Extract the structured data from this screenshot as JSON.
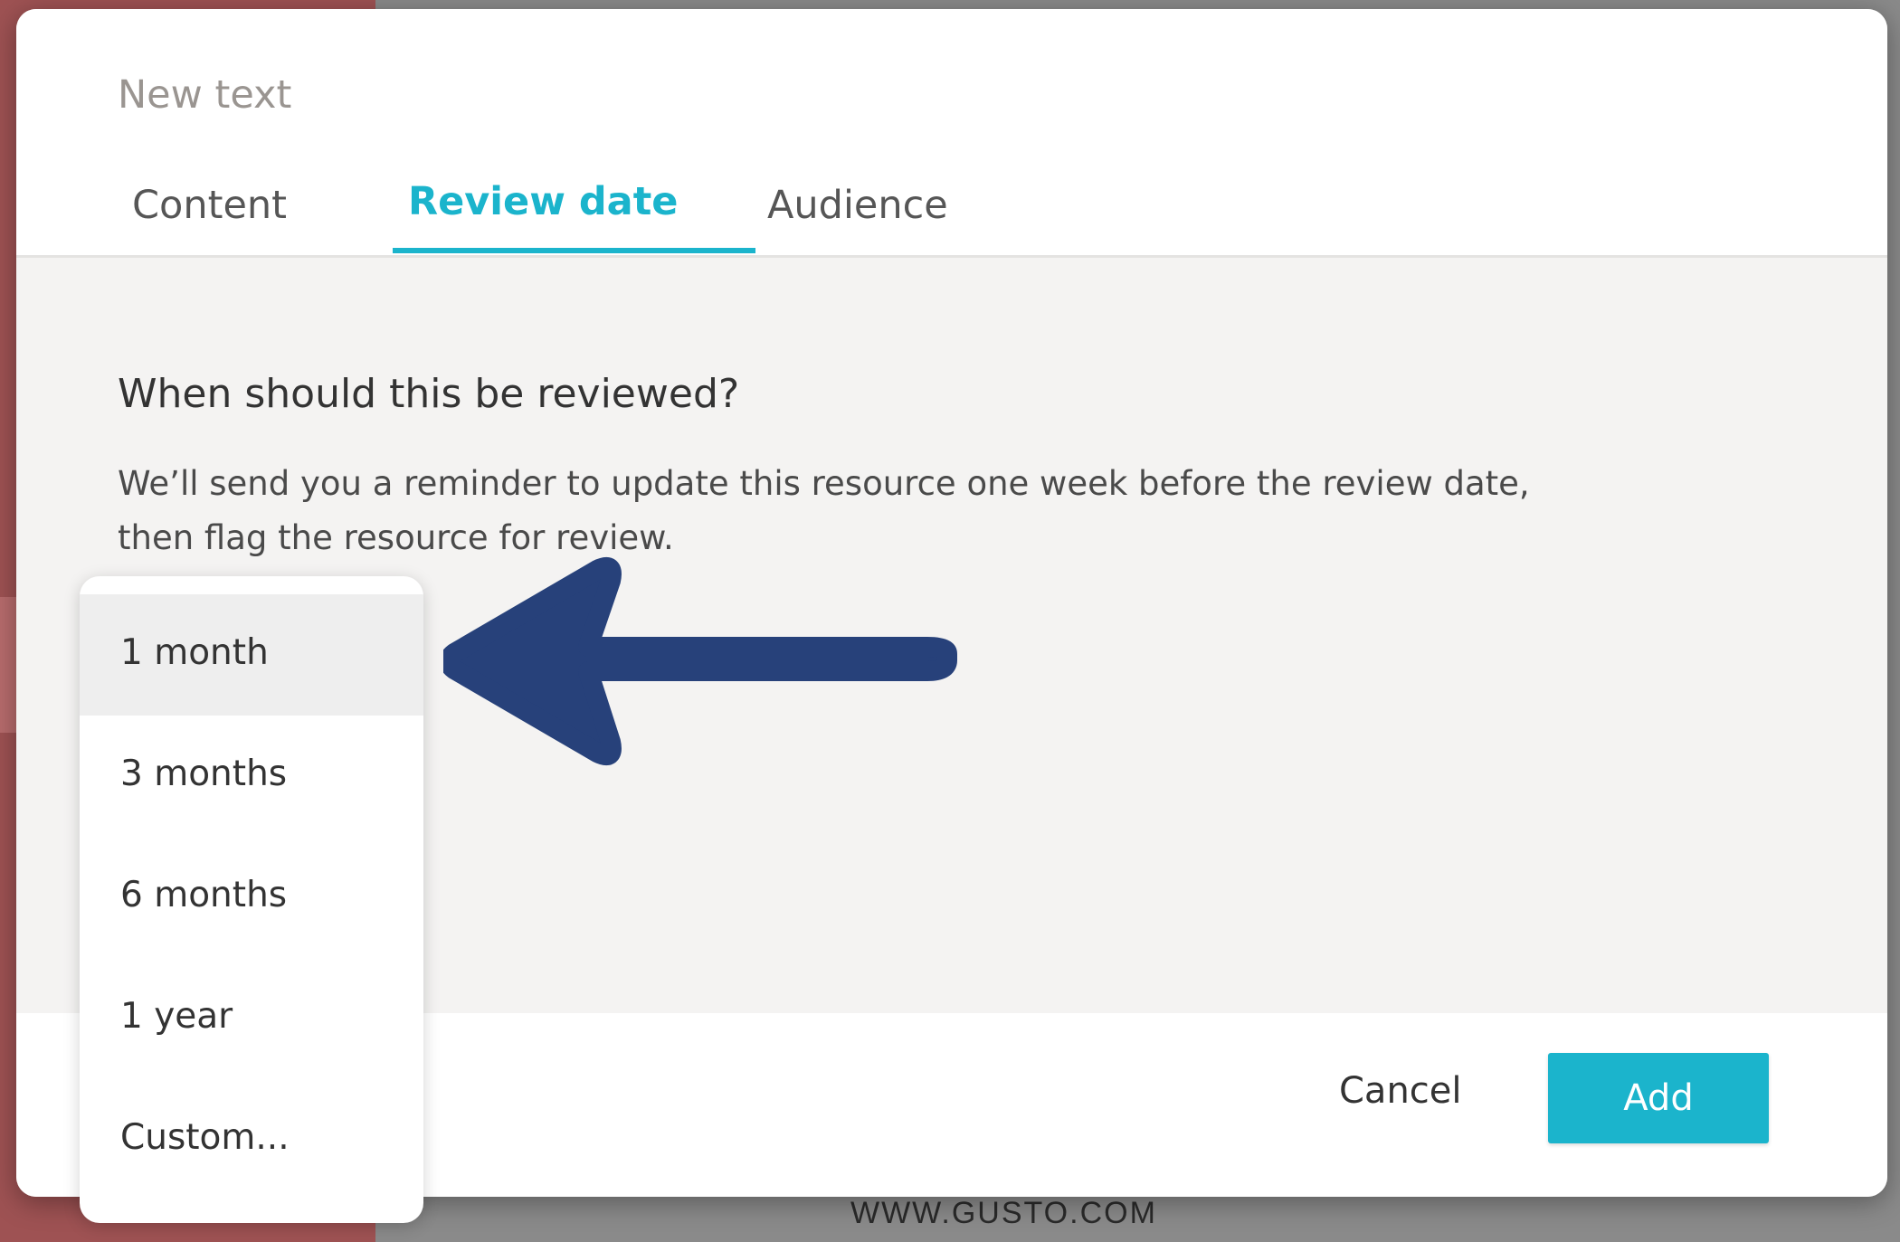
{
  "background": {
    "footer_url": "WWW.GUSTO.COM"
  },
  "modal": {
    "title": "New text",
    "tabs": [
      {
        "label": "Content"
      },
      {
        "label": "Review date"
      },
      {
        "label": "Audience"
      }
    ],
    "active_tab": "Review date",
    "question": "When should this be reviewed?",
    "description": "We’ll send you a reminder to update this resource one week before the review date, then flag the resource for review.",
    "footer": {
      "cancel_label": "Cancel",
      "add_label": "Add"
    }
  },
  "dropdown": {
    "selected": "1 month",
    "options": [
      {
        "label": "1 month"
      },
      {
        "label": "3 months"
      },
      {
        "label": "6 months"
      },
      {
        "label": "1 year"
      },
      {
        "label": "Custom..."
      }
    ]
  },
  "colors": {
    "accent": "#1bb4cc",
    "arrow": "#27417a"
  },
  "icons": {
    "annotation_arrow": "arrow-left-icon"
  }
}
